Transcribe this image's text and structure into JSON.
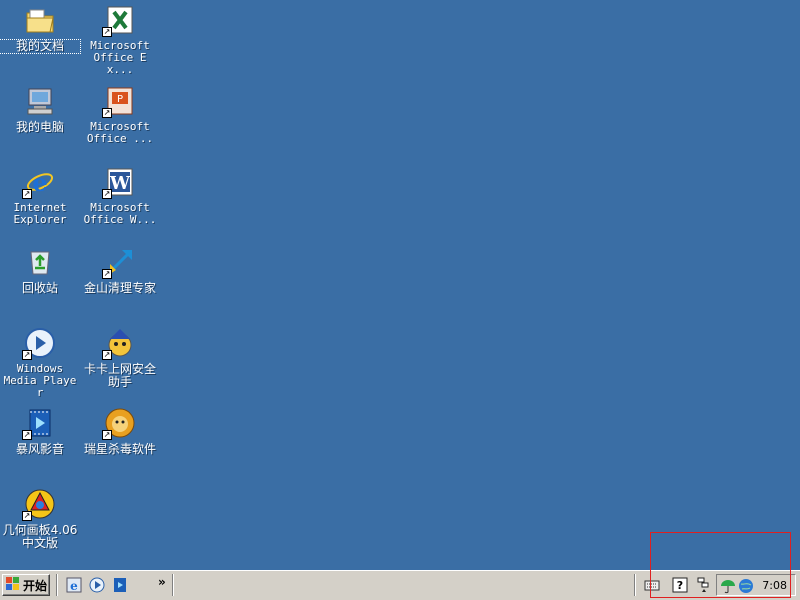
{
  "desktop": {
    "background_color": "#3a6ea5",
    "icons": [
      {
        "id": "my-documents",
        "label": "我的文档",
        "icon": "folder-documents-icon",
        "shortcut": false,
        "selected": true
      },
      {
        "id": "excel",
        "label": "Microsoft\nOffice Ex...",
        "icon": "excel-icon",
        "shortcut": true
      },
      {
        "id": "my-computer",
        "label": "我的电脑",
        "icon": "computer-icon",
        "shortcut": false
      },
      {
        "id": "powerpoint",
        "label": "Microsoft\nOffice ...",
        "icon": "powerpoint-icon",
        "shortcut": true
      },
      {
        "id": "ie",
        "label": "Internet\nExplorer",
        "icon": "internet-explorer-icon",
        "shortcut": true
      },
      {
        "id": "word",
        "label": "Microsoft\nOffice W...",
        "icon": "word-icon",
        "shortcut": true
      },
      {
        "id": "recycle-bin",
        "label": "回收站",
        "icon": "recycle-bin-icon",
        "shortcut": false
      },
      {
        "id": "kingsoft-cleaner",
        "label": "金山清理专家",
        "icon": "kingsoft-cleaner-icon",
        "shortcut": true
      },
      {
        "id": "wmp",
        "label": "Windows\nMedia Player",
        "icon": "media-player-icon",
        "shortcut": true
      },
      {
        "id": "kaka",
        "label": "卡卡上网安全\n助手",
        "icon": "kaka-assistant-icon",
        "shortcut": true
      },
      {
        "id": "baofeng",
        "label": "暴风影音",
        "icon": "baofeng-player-icon",
        "shortcut": true
      },
      {
        "id": "rising",
        "label": "瑞星杀毒软件",
        "icon": "rising-antivirus-icon",
        "shortcut": true
      },
      {
        "id": "geometry",
        "label": "几何画板4.06\n中文版",
        "icon": "geometry-sketchpad-icon",
        "shortcut": true
      }
    ]
  },
  "taskbar": {
    "start_label": "开始",
    "quick_launch_chevron": "»",
    "quick_launch": [
      "internet-explorer-icon",
      "media-player-icon",
      "baofeng-player-icon"
    ],
    "clock": "7:08",
    "tray_icons": [
      "keyboard-icon",
      "help-icon",
      "network-icon",
      "umbrella-icon",
      "globe-icon"
    ]
  },
  "annotation": {
    "highlight_color": "#e02020"
  }
}
